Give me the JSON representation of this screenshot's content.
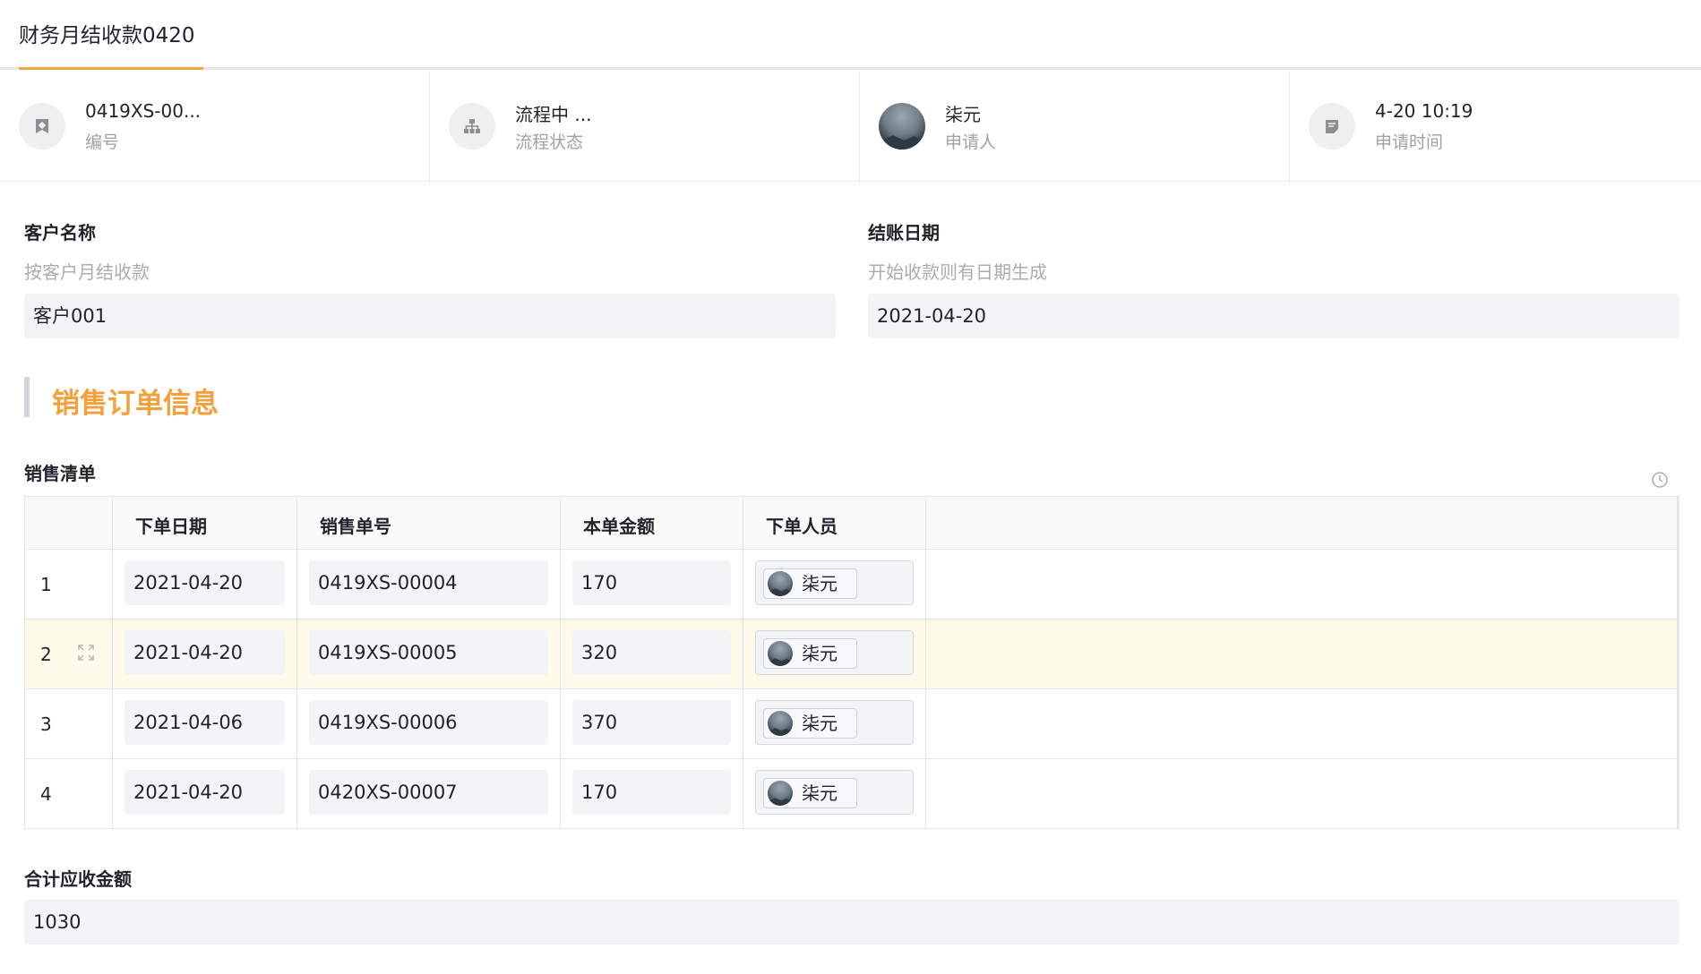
{
  "tab": {
    "title": "财务月结收款0420"
  },
  "info": [
    {
      "value": "0419XS-00...",
      "label": "编号",
      "icon": "bookmark-icon"
    },
    {
      "value": "流程中 ...",
      "label": "流程状态",
      "icon": "flow-icon"
    },
    {
      "value": "柒元",
      "label": "申请人",
      "icon": "avatar"
    },
    {
      "value": "4-20 10:19",
      "label": "申请时间",
      "icon": "note-icon"
    }
  ],
  "customer": {
    "title": "客户名称",
    "hint": "按客户月结收款",
    "value": "客户001"
  },
  "closing_date": {
    "title": "结账日期",
    "hint": "开始收款则有日期生成",
    "value": "2021-04-20"
  },
  "section": {
    "title": "销售订单信息"
  },
  "sales_list": {
    "title": "销售清单",
    "headers": [
      "下单日期",
      "销售单号",
      "本单金额",
      "下单人员"
    ],
    "rows": [
      {
        "no": "1",
        "date": "2021-04-20",
        "order": "0419XS-00004",
        "amount": "170",
        "person": "柒元"
      },
      {
        "no": "2",
        "date": "2021-04-20",
        "order": "0419XS-00005",
        "amount": "320",
        "person": "柒元"
      },
      {
        "no": "3",
        "date": "2021-04-06",
        "order": "0419XS-00006",
        "amount": "370",
        "person": "柒元"
      },
      {
        "no": "4",
        "date": "2021-04-20",
        "order": "0420XS-00007",
        "amount": "170",
        "person": "柒元"
      }
    ]
  },
  "total": {
    "title": "合计应收金额",
    "value": "1030"
  },
  "colors": {
    "accent": "#f5a03c",
    "tab_underline": "#f6a546",
    "row_highlight": "#fffbea"
  }
}
